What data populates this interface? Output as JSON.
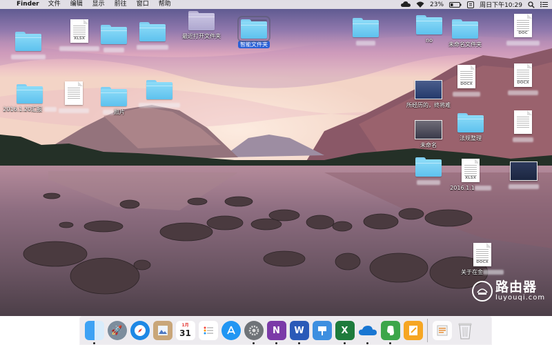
{
  "menubar": {
    "apple_glyph": "",
    "app_name": "Finder",
    "menus": [
      "文件",
      "编辑",
      "显示",
      "前往",
      "窗口",
      "帮助"
    ],
    "battery": "23%",
    "datetime": "周日下午10:29"
  },
  "desktop": {
    "recent_folders": "最近打开文件夹",
    "smart_folder": "智能文件夹",
    "no": "no",
    "untitled_folder": "未命名文件夹",
    "folder_2016": "2016.1.20汇报",
    "photo_suffix": "照片",
    "experience": "所经历的，终将难",
    "untitled": "未命名",
    "regulations": "法规整理",
    "doc_2016": "2016.1.1",
    "about_xy": "关于在金",
    "doc_ext_docx": "DOCX",
    "doc_ext_xlsx": "XLSX",
    "doc_ext_doc": "DOC"
  },
  "dock": {
    "items": [
      "finder-icon",
      "launchpad-icon",
      "safari-icon",
      "preview-icon",
      "calendar-icon",
      "reminders-icon",
      "app-store-icon",
      "system-preferences-icon",
      "onenote-icon",
      "word-icon",
      "keynote-icon",
      "excel-icon",
      "onedrive-icon",
      "evernote-icon",
      "pages-icon",
      "downloads-stack-icon",
      "trash-icon"
    ],
    "calendar_month": "1月",
    "calendar_day": "31",
    "onenote_letter": "N",
    "word_letter": "W",
    "excel_letter": "X"
  },
  "watermark": {
    "brand_cn": "路由器",
    "brand_en": "luyouqi.com"
  }
}
